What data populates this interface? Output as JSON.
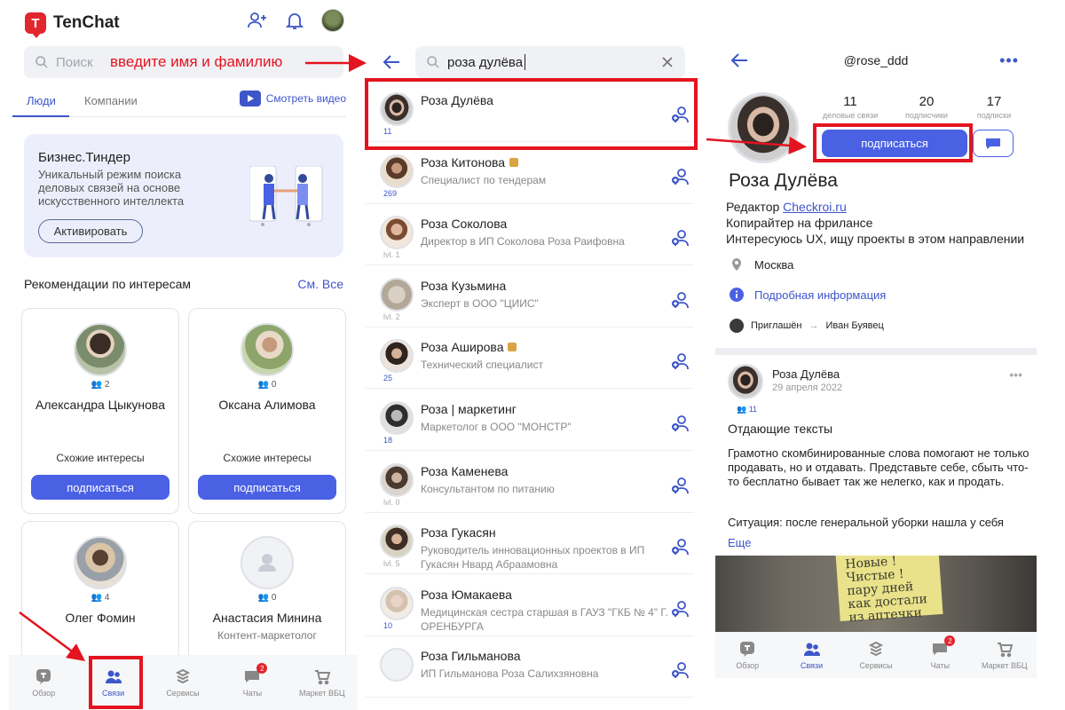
{
  "panel1": {
    "app_name": "TenChat",
    "search_placeholder": "Поиск",
    "annotation": "введите имя и фамилию",
    "tabs": [
      "Люди",
      "Компании"
    ],
    "watch_video": "Смотреть видео",
    "promo": {
      "title": "Бизнес.Тиндер",
      "text": "Уникальный режим поиска деловых связей на основе искусственного интеллекта",
      "button": "Активировать"
    },
    "recommendations_title": "Рекомендации по интересам",
    "see_all": "См. Все",
    "cards": [
      {
        "count": "2",
        "name": "Александра Цыкунова",
        "subtitle": "",
        "similar": "Схожие интересы",
        "button": "подписаться"
      },
      {
        "count": "0",
        "name": "Оксана Алимова",
        "subtitle": "",
        "similar": "Схожие интересы",
        "button": "подписаться"
      },
      {
        "count": "4",
        "name": "Олег  Фомин",
        "subtitle": "",
        "similar": "",
        "button": ""
      },
      {
        "count": "0",
        "name": "Анастасия Минина",
        "subtitle": "Контент-маркетолог",
        "similar": "",
        "button": ""
      }
    ],
    "nav": [
      {
        "label": "Обзор",
        "icon": "overview-icon"
      },
      {
        "label": "Связи",
        "icon": "connections-icon"
      },
      {
        "label": "Сервисы",
        "icon": "services-icon"
      },
      {
        "label": "Чаты",
        "icon": "chats-icon",
        "badge": "2"
      },
      {
        "label": "Маркет ВБЦ",
        "icon": "market-icon"
      }
    ]
  },
  "panel2": {
    "search_value": "роза дулёва",
    "results": [
      {
        "name": "Роза Дулёва",
        "subtitle": "",
        "count": "11",
        "gold": false
      },
      {
        "name": "Роза  Китонова",
        "subtitle": "Специалист по тендерам",
        "count": "269",
        "gold": true
      },
      {
        "name": "Роза Соколова",
        "subtitle": "Директор в ИП Соколова Роза Раифовна",
        "count": "lvl. 1",
        "gold": false
      },
      {
        "name": "Роза Кузьмина",
        "subtitle": "Эксперт в ООО \"ЦИИС\"",
        "count": "lvl. 2",
        "gold": false
      },
      {
        "name": "Роза Аширова",
        "subtitle": "Технический специалист",
        "count": "25",
        "gold": true
      },
      {
        "name": "Роза | маркетинг",
        "subtitle": "Маркетолог в ООО \"МОНСТР\"",
        "count": "18",
        "gold": false
      },
      {
        "name": "Роза Каменева",
        "subtitle": "Консультантом по питанию",
        "count": "lvl. 0",
        "gold": false
      },
      {
        "name": "Роза Гукасян",
        "subtitle": "Руководитель инновационных проектов в ИП Гукасян Нвард Абраамовна",
        "count": "lvl. 5",
        "gold": false
      },
      {
        "name": "Роза Юмакаева",
        "subtitle": "Медицинская сестра старшая в ГАУЗ \"ГКБ № 4\" Г. ОРЕНБУРГА",
        "count": "10",
        "gold": false
      },
      {
        "name": "Роза Гильманова",
        "subtitle": "ИП Гильманова Роза Салихзяновна",
        "count": "",
        "gold": false
      }
    ]
  },
  "panel3": {
    "handle": "@rose_ddd",
    "stats": [
      {
        "value": "11",
        "label": "деловые связи"
      },
      {
        "value": "20",
        "label": "подписчики"
      },
      {
        "value": "17",
        "label": "подписки"
      }
    ],
    "subscribe": "подписаться",
    "name": "Роза Дулёва",
    "bio_prefix": "Редактор ",
    "bio_link": "Checkroi.ru",
    "bio_line2": "Копирайтер на фрилансе",
    "bio_line3": "Интересуюсь UX, ищу проекты в этом направлении",
    "city": "Москва",
    "details": "Подробная информация",
    "invited_label": "Приглашён",
    "invited_by": "Иван Буявец",
    "post": {
      "author": "Роза Дулёва",
      "date": "29 апреля 2022",
      "count": "11",
      "title": "Отдающие тексты",
      "body": "Грамотно скомбинированные слова помогают не только продавать, но и отдавать. Представьте себе, сбыть что-то бесплатно бывает так же нелегко, как и продать.",
      "body2": "Ситуация: после генеральной уборки нашла у себя",
      "more": "Еще",
      "photo_text": "Новые ! Чистые ! пару дней как достали из аптечки"
    },
    "nav": [
      {
        "label": "Обзор"
      },
      {
        "label": "Связи"
      },
      {
        "label": "Сервисы"
      },
      {
        "label": "Чаты",
        "badge": "2"
      },
      {
        "label": "Маркет ВБЦ"
      }
    ]
  },
  "colors": {
    "accent": "#4a61e4",
    "red": "#e3141f",
    "brand": "#e1262d"
  }
}
